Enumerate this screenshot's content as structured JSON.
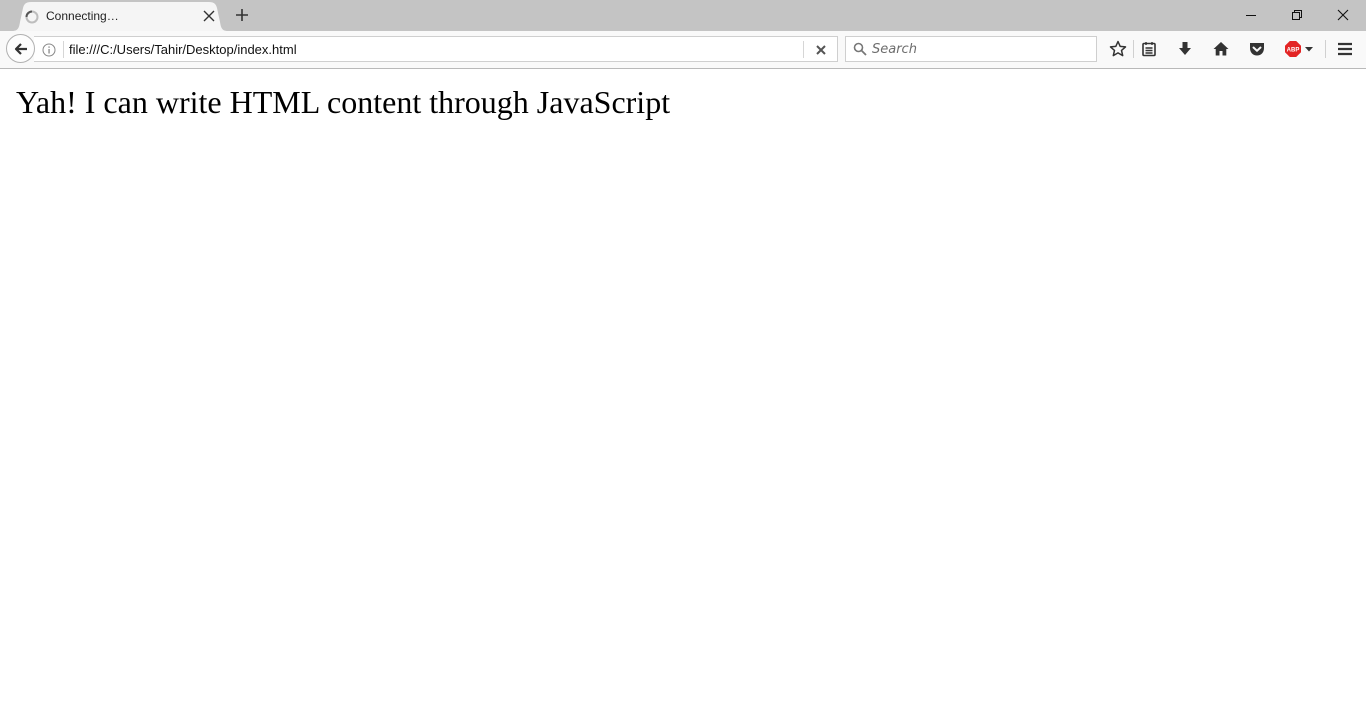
{
  "tab": {
    "title": "Connecting…",
    "loading": true
  },
  "navbar": {
    "url": "file:///C:/Users/Tahir/Desktop/index.html",
    "search_placeholder": "Search"
  },
  "toolbar": {
    "icons": [
      "bookmark-star-icon",
      "reading-list-icon",
      "download-icon",
      "home-icon",
      "pocket-icon",
      "adblock-plus-icon",
      "hamburger-menu-icon"
    ],
    "adblock_label": "ABP",
    "adblock_color": "#e32424"
  },
  "window_controls": [
    "minimize",
    "restore",
    "close"
  ],
  "content": {
    "text": "Yah! I can write HTML content through JavaScript"
  }
}
